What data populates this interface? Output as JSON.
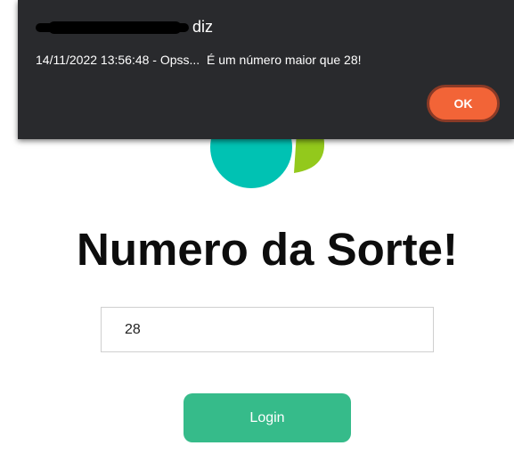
{
  "alert": {
    "origin_suffix": "diz",
    "message": "14/11/2022 13:56:48 - Opss...  É um número maior que 28!",
    "ok_label": "OK"
  },
  "main": {
    "title": "Numero da Sorte!",
    "number_value": "28",
    "login_label": "Login"
  },
  "colors": {
    "dialog_bg": "#292a2d",
    "ok_button": "#f26437",
    "login_button": "#36bb8a",
    "logo_teal": "#00c2b3",
    "logo_green": "#93c91c"
  }
}
